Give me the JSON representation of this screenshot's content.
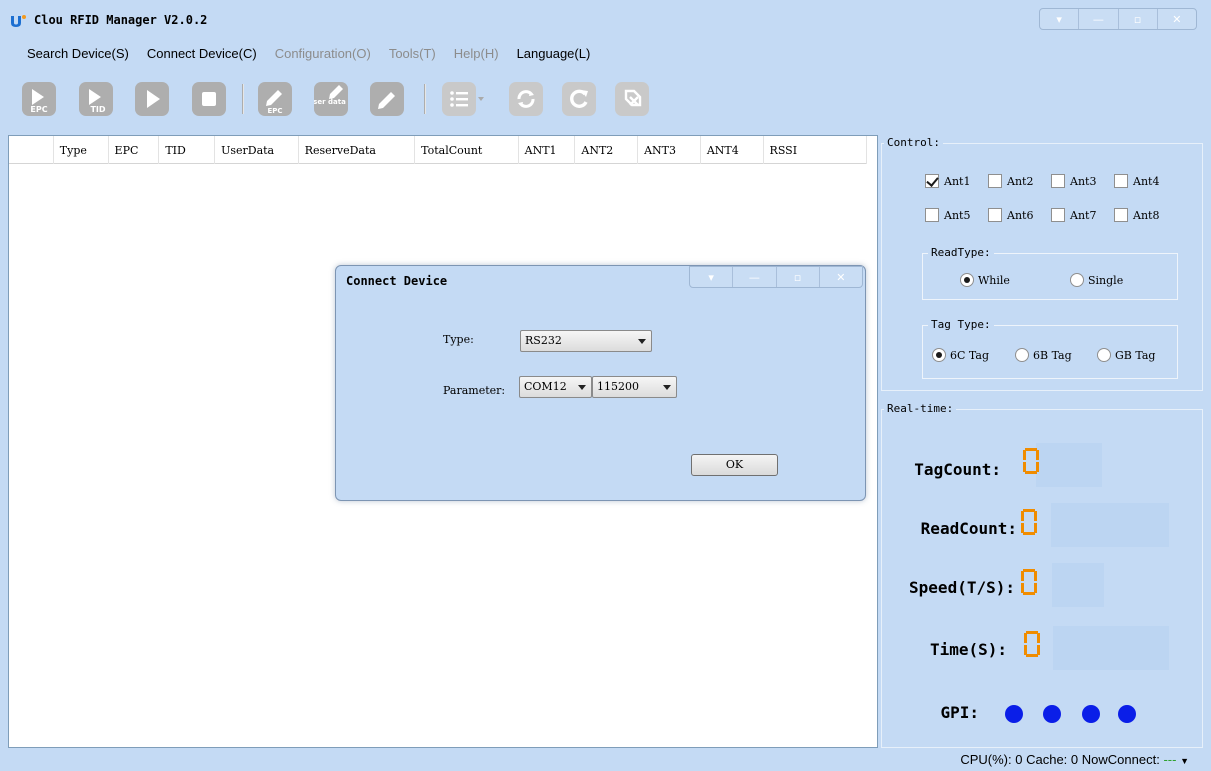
{
  "window": {
    "title": "Clou RFID Manager V2.0.2",
    "controls": [
      "menu-icon",
      "minimize-icon",
      "maximize-icon",
      "close-icon"
    ]
  },
  "menu": [
    {
      "label": "Search Device(S)",
      "enabled": true
    },
    {
      "label": "Connect Device(C)",
      "enabled": true
    },
    {
      "label": "Configuration(O)",
      "enabled": false
    },
    {
      "label": "Tools(T)",
      "enabled": false
    },
    {
      "label": "Help(H)",
      "enabled": false
    },
    {
      "label": "Language(L)",
      "enabled": true
    }
  ],
  "toolbar": {
    "read_epc_label": "EPC",
    "read_tid_label": "TID",
    "write_epc_label": "EPC",
    "write_userdata_label": "user data",
    "icons": [
      "read-epc-icon",
      "read-tid-icon",
      "play-icon",
      "stop-icon",
      "write-epc-icon",
      "write-userdata-icon",
      "edit-icon",
      "list-menu-icon",
      "refresh-icon",
      "reload-icon",
      "disconnect-icon"
    ]
  },
  "grid": {
    "columns": [
      "",
      "Type",
      "EPC",
      "TID",
      "UserData",
      "ReserveData",
      "TotalCount",
      "ANT1",
      "ANT2",
      "ANT3",
      "ANT4",
      "RSSI"
    ]
  },
  "control": {
    "title": "Control:",
    "antennas": [
      {
        "label": "Ant1",
        "checked": true
      },
      {
        "label": "Ant2",
        "checked": false
      },
      {
        "label": "Ant3",
        "checked": false
      },
      {
        "label": "Ant4",
        "checked": false
      },
      {
        "label": "Ant5",
        "checked": false
      },
      {
        "label": "Ant6",
        "checked": false
      },
      {
        "label": "Ant7",
        "checked": false
      },
      {
        "label": "Ant8",
        "checked": false
      }
    ],
    "read_type": {
      "title": "ReadType:",
      "options": [
        {
          "label": "While",
          "selected": true
        },
        {
          "label": "Single",
          "selected": false
        }
      ]
    },
    "tag_type": {
      "title": "Tag Type:",
      "options": [
        {
          "label": "6C Tag",
          "selected": true
        },
        {
          "label": "6B Tag",
          "selected": false
        },
        {
          "label": "GB Tag",
          "selected": false
        }
      ]
    }
  },
  "realtime": {
    "title": "Real-time:",
    "tag_count_label": "TagCount:",
    "tag_count_value": "0",
    "read_count_label": "ReadCount:",
    "read_count_value": "0",
    "speed_label": "Speed(T/S):",
    "speed_value": "0",
    "time_label": "Time(S):",
    "time_value": "0",
    "gpi_label": "GPI:",
    "gpi_count": 4,
    "digit_color": "#f08c00",
    "gpi_color": "#0a1ee8"
  },
  "status": {
    "cpu_label": "CPU(%):",
    "cpu_value": "0",
    "cache_label": "Cache:",
    "cache_value": "0",
    "now_connect_label": "NowConnect:",
    "now_connect_value": "---"
  },
  "dialog": {
    "title": "Connect Device",
    "type_label": "Type:",
    "type_value": "RS232",
    "parameter_label": "Parameter:",
    "port_value": "COM12",
    "baud_value": "115200",
    "ok_label": "OK"
  }
}
